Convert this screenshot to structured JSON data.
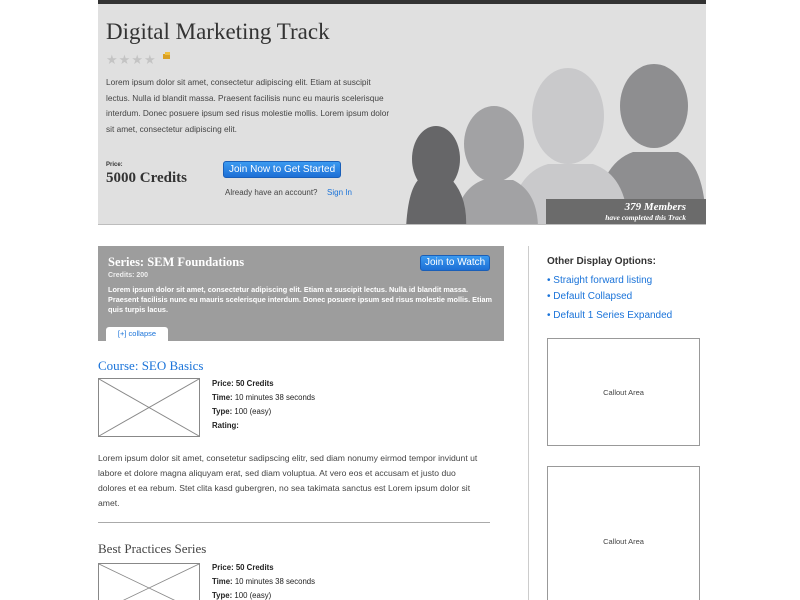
{
  "hero": {
    "title": "Digital Marketing Track",
    "rating_stars": 4,
    "description": "Lorem ipsum dolor sit amet, consectetur adipiscing elit. Etiam at suscipit lectus. Nulla id blandit massa. Praesent facilisis nunc eu mauris scelerisque interdum. Donec posuere ipsum sed risus molestie mollis. Lorem ipsum dolor sit amet, consectetur adipiscing elit.",
    "price_label": "Price:",
    "price_value": "5000 Credits",
    "join_label": "Join Now to Get Started",
    "already_text": "Already have an account?",
    "signin_label": "Sign In",
    "members_count": "379 Members",
    "members_sub": "have completed this Track"
  },
  "series": {
    "title": "Series: SEM Foundations",
    "credits": "Credits: 200",
    "description": "Lorem ipsum dolor sit amet, consectetur adipiscing elit. Etiam at suscipit lectus. Nulla id blandit massa. Praesent facilisis nunc eu mauris scelerisque interdum. Donec posuere ipsum sed risus molestie mollis. Etiam quis turpis lacus.",
    "watch_label": "Join to Watch",
    "collapse_label": "[+] collapse"
  },
  "courses": [
    {
      "title": "Course: SEO Basics",
      "price_label": "Price:",
      "price": "50 Credits",
      "time_label": "Time:",
      "time": "10 minutes 38 seconds",
      "type_label": "Type:",
      "type": "100 (easy)",
      "rating_label": "Rating:",
      "description": "Lorem ipsum dolor sit amet, consetetur sadipscing elitr, sed diam nonumy eirmod tempor invidunt ut labore et dolore magna aliquyam erat, sed diam voluptua. At vero eos et accusam et justo duo dolores et ea rebum. Stet clita kasd gubergren, no sea takimata sanctus est Lorem ipsum dolor sit amet."
    },
    {
      "title": "Best Practices Series",
      "price_label": "Price:",
      "price": "50 Credits",
      "time_label": "Time:",
      "time": "10 minutes 38 seconds",
      "type_label": "Type:",
      "type": "100 (easy)"
    }
  ],
  "sidebar": {
    "title": "Other Display Options:",
    "options": [
      "Straight forward listing",
      "Default Collapsed",
      "Default 1 Series Expanded"
    ],
    "callout_1": "Callout Area",
    "callout_2": "Callout Area"
  },
  "colors": {
    "link": "#1a73d9",
    "button": "#1d6fd6",
    "hero_bg": "#e0e0e0",
    "series_bg": "#9d9d9d"
  }
}
